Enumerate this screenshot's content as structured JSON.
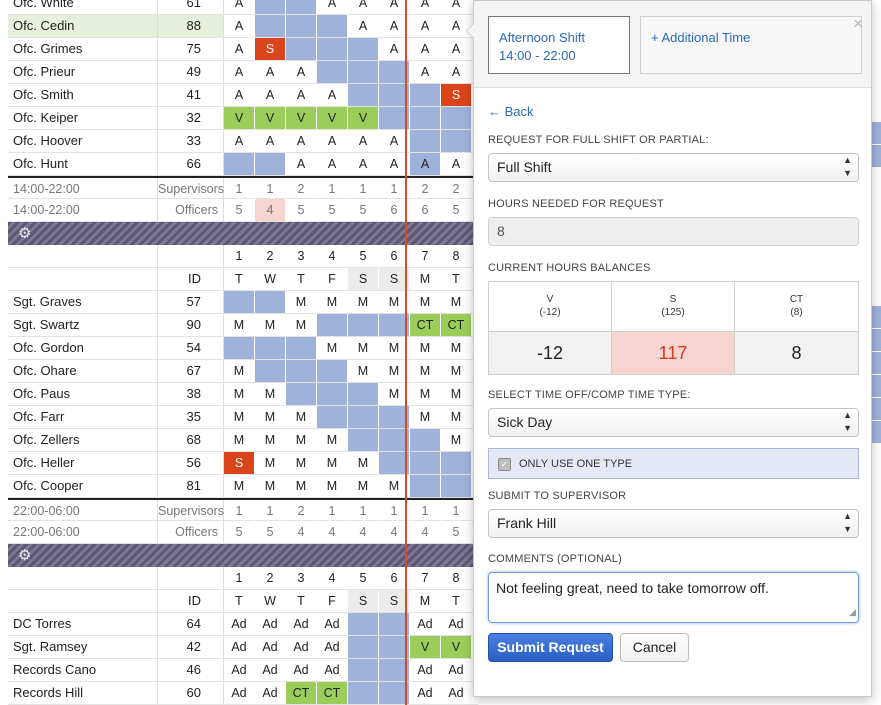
{
  "cols": 8,
  "grid": [
    {
      "kind": "person",
      "name": "Ofc. White",
      "id": "61",
      "cells": [
        [
          "A",
          ""
        ],
        [
          "",
          "blue"
        ],
        [
          "",
          "blue"
        ],
        [
          "A",
          ""
        ],
        [
          "A",
          ""
        ],
        [
          "A",
          ""
        ],
        [
          "A",
          ""
        ],
        [
          "A",
          ""
        ]
      ]
    },
    {
      "kind": "person",
      "name": "Ofc. Cedin",
      "id": "88",
      "hl": true,
      "cells": [
        [
          "A",
          ""
        ],
        [
          "",
          "blue"
        ],
        [
          "",
          "blue"
        ],
        [
          "",
          "blue"
        ],
        [
          "A",
          ""
        ],
        [
          "A",
          ""
        ],
        [
          "A",
          ""
        ],
        [
          "A",
          ""
        ]
      ]
    },
    {
      "kind": "person",
      "name": "Ofc. Grimes",
      "id": "75",
      "cells": [
        [
          "A",
          ""
        ],
        [
          "S",
          "red"
        ],
        [
          "",
          "blue"
        ],
        [
          "",
          "blue"
        ],
        [
          "",
          "blue"
        ],
        [
          "A",
          ""
        ],
        [
          "A",
          ""
        ],
        [
          "A",
          ""
        ]
      ]
    },
    {
      "kind": "person",
      "name": "Ofc. Prieur",
      "id": "49",
      "cells": [
        [
          "A",
          ""
        ],
        [
          "A",
          ""
        ],
        [
          "A",
          ""
        ],
        [
          "",
          "blue"
        ],
        [
          "",
          "blue"
        ],
        [
          "",
          "blue"
        ],
        [
          "A",
          ""
        ],
        [
          "A",
          ""
        ]
      ]
    },
    {
      "kind": "person",
      "name": "Ofc. Smith",
      "id": "41",
      "cells": [
        [
          "A",
          ""
        ],
        [
          "A",
          ""
        ],
        [
          "A",
          ""
        ],
        [
          "A",
          ""
        ],
        [
          "",
          "blue"
        ],
        [
          "",
          "blue"
        ],
        [
          "",
          "blue"
        ],
        [
          "S",
          "red"
        ]
      ]
    },
    {
      "kind": "person",
      "name": "Ofc. Keiper",
      "id": "32",
      "cells": [
        [
          "V",
          "green"
        ],
        [
          "V",
          "green"
        ],
        [
          "V",
          "green"
        ],
        [
          "V",
          "green"
        ],
        [
          "V",
          "green"
        ],
        [
          "",
          "blue"
        ],
        [
          "",
          "blue"
        ],
        [
          "",
          "blue"
        ]
      ]
    },
    {
      "kind": "person",
      "name": "Ofc. Hoover",
      "id": "33",
      "cells": [
        [
          "A",
          ""
        ],
        [
          "A",
          ""
        ],
        [
          "A",
          ""
        ],
        [
          "A",
          ""
        ],
        [
          "A",
          ""
        ],
        [
          "A",
          ""
        ],
        [
          "",
          "blue"
        ],
        [
          "",
          "blue"
        ]
      ]
    },
    {
      "kind": "person",
      "name": "Ofc. Hunt",
      "id": "66",
      "cells": [
        [
          "",
          "blue"
        ],
        [
          "",
          "blue"
        ],
        [
          "A",
          ""
        ],
        [
          "A",
          ""
        ],
        [
          "A",
          ""
        ],
        [
          "A",
          ""
        ],
        [
          "A",
          "blue"
        ],
        [
          "A",
          ""
        ]
      ]
    },
    {
      "kind": "sum",
      "first": true,
      "name": "14:00-22:00",
      "id": "Supervisors",
      "cells": [
        [
          "1",
          ""
        ],
        [
          "1",
          ""
        ],
        [
          "2",
          ""
        ],
        [
          "1",
          ""
        ],
        [
          "1",
          ""
        ],
        [
          "1",
          ""
        ],
        [
          "2",
          ""
        ],
        [
          "2",
          ""
        ]
      ]
    },
    {
      "kind": "sum",
      "name": "14:00-22:00",
      "id": "Officers",
      "cells": [
        [
          "5",
          ""
        ],
        [
          "4",
          "pink"
        ],
        [
          "5",
          ""
        ],
        [
          "5",
          ""
        ],
        [
          "5",
          ""
        ],
        [
          "6",
          ""
        ],
        [
          "6",
          ""
        ],
        [
          "5",
          ""
        ]
      ]
    },
    {
      "kind": "band",
      "gear": "⚙"
    },
    {
      "kind": "hdr",
      "name": "",
      "id": "",
      "cells": [
        [
          "1",
          ""
        ],
        [
          "2",
          ""
        ],
        [
          "3",
          ""
        ],
        [
          "4",
          ""
        ],
        [
          "5",
          ""
        ],
        [
          "6",
          ""
        ],
        [
          "7",
          ""
        ],
        [
          "8",
          ""
        ]
      ]
    },
    {
      "kind": "hdr",
      "name": "",
      "id": "ID",
      "cells": [
        [
          "T",
          ""
        ],
        [
          "W",
          ""
        ],
        [
          "T",
          ""
        ],
        [
          "F",
          ""
        ],
        [
          "S",
          "gray"
        ],
        [
          "S",
          "gray"
        ],
        [
          "M",
          ""
        ],
        [
          "T",
          ""
        ]
      ]
    },
    {
      "kind": "person",
      "name": "Sgt. Graves",
      "id": "57",
      "cells": [
        [
          "",
          "blue"
        ],
        [
          "",
          "blue"
        ],
        [
          "M",
          ""
        ],
        [
          "M",
          ""
        ],
        [
          "M",
          ""
        ],
        [
          "M",
          ""
        ],
        [
          "M",
          ""
        ],
        [
          "M",
          ""
        ]
      ]
    },
    {
      "kind": "person",
      "name": "Sgt. Swartz",
      "id": "90",
      "cells": [
        [
          "M",
          ""
        ],
        [
          "M",
          ""
        ],
        [
          "M",
          ""
        ],
        [
          "",
          "blue"
        ],
        [
          "",
          "blue"
        ],
        [
          "",
          "blue"
        ],
        [
          "CT",
          "green"
        ],
        [
          "CT",
          "green"
        ]
      ]
    },
    {
      "kind": "person",
      "name": "Ofc. Gordon",
      "id": "54",
      "cells": [
        [
          "",
          "blue"
        ],
        [
          "",
          "blue"
        ],
        [
          "",
          "blue"
        ],
        [
          "M",
          ""
        ],
        [
          "M",
          ""
        ],
        [
          "M",
          ""
        ],
        [
          "M",
          ""
        ],
        [
          "M",
          ""
        ]
      ]
    },
    {
      "kind": "person",
      "name": "Ofc. Ohare",
      "id": "67",
      "cells": [
        [
          "M",
          ""
        ],
        [
          "",
          "blue"
        ],
        [
          "",
          "blue"
        ],
        [
          "",
          "blue"
        ],
        [
          "M",
          ""
        ],
        [
          "M",
          ""
        ],
        [
          "M",
          ""
        ],
        [
          "M",
          ""
        ]
      ]
    },
    {
      "kind": "person",
      "name": "Ofc. Paus",
      "id": "38",
      "cells": [
        [
          "M",
          ""
        ],
        [
          "M",
          ""
        ],
        [
          "",
          "blue"
        ],
        [
          "",
          "blue"
        ],
        [
          "",
          "blue"
        ],
        [
          "M",
          ""
        ],
        [
          "M",
          ""
        ],
        [
          "M",
          ""
        ]
      ]
    },
    {
      "kind": "person",
      "name": "Ofc. Farr",
      "id": "35",
      "cells": [
        [
          "M",
          ""
        ],
        [
          "M",
          ""
        ],
        [
          "M",
          ""
        ],
        [
          "",
          "blue"
        ],
        [
          "",
          "blue"
        ],
        [
          "",
          "blue"
        ],
        [
          "M",
          ""
        ],
        [
          "M",
          ""
        ]
      ]
    },
    {
      "kind": "person",
      "name": "Ofc. Zellers",
      "id": "68",
      "cells": [
        [
          "M",
          ""
        ],
        [
          "M",
          ""
        ],
        [
          "M",
          ""
        ],
        [
          "M",
          ""
        ],
        [
          "",
          "blue"
        ],
        [
          "",
          "blue"
        ],
        [
          "",
          "blue"
        ],
        [
          "M",
          ""
        ]
      ]
    },
    {
      "kind": "person",
      "name": "Ofc. Heller",
      "id": "56",
      "cells": [
        [
          "S",
          "red"
        ],
        [
          "M",
          ""
        ],
        [
          "M",
          ""
        ],
        [
          "M",
          ""
        ],
        [
          "M",
          ""
        ],
        [
          "",
          "blue"
        ],
        [
          "",
          "blue"
        ],
        [
          "",
          "blue"
        ]
      ]
    },
    {
      "kind": "person",
      "name": "Ofc. Cooper",
      "id": "81",
      "cells": [
        [
          "M",
          ""
        ],
        [
          "M",
          ""
        ],
        [
          "M",
          ""
        ],
        [
          "M",
          ""
        ],
        [
          "M",
          ""
        ],
        [
          "M",
          ""
        ],
        [
          "",
          "blue"
        ],
        [
          "",
          "blue"
        ]
      ]
    },
    {
      "kind": "sum",
      "first": true,
      "name": "22:00-06:00",
      "id": "Supervisors",
      "cells": [
        [
          "1",
          ""
        ],
        [
          "1",
          ""
        ],
        [
          "2",
          ""
        ],
        [
          "1",
          ""
        ],
        [
          "1",
          ""
        ],
        [
          "1",
          ""
        ],
        [
          "1",
          ""
        ],
        [
          "1",
          ""
        ]
      ]
    },
    {
      "kind": "sum",
      "name": "22:00-06:00",
      "id": "Officers",
      "cells": [
        [
          "5",
          ""
        ],
        [
          "5",
          ""
        ],
        [
          "4",
          ""
        ],
        [
          "4",
          ""
        ],
        [
          "4",
          ""
        ],
        [
          "4",
          ""
        ],
        [
          "4",
          ""
        ],
        [
          "5",
          ""
        ]
      ]
    },
    {
      "kind": "band",
      "gear": "⚙"
    },
    {
      "kind": "hdr",
      "name": "",
      "id": "",
      "cells": [
        [
          "1",
          ""
        ],
        [
          "2",
          ""
        ],
        [
          "3",
          ""
        ],
        [
          "4",
          ""
        ],
        [
          "5",
          ""
        ],
        [
          "6",
          ""
        ],
        [
          "7",
          ""
        ],
        [
          "8",
          ""
        ]
      ]
    },
    {
      "kind": "hdr",
      "name": "",
      "id": "ID",
      "cells": [
        [
          "T",
          ""
        ],
        [
          "W",
          ""
        ],
        [
          "T",
          ""
        ],
        [
          "F",
          ""
        ],
        [
          "S",
          "gray"
        ],
        [
          "S",
          "gray"
        ],
        [
          "M",
          ""
        ],
        [
          "T",
          ""
        ]
      ]
    },
    {
      "kind": "person",
      "name": "DC Torres",
      "id": "64",
      "cells": [
        [
          "Ad",
          ""
        ],
        [
          "Ad",
          ""
        ],
        [
          "Ad",
          ""
        ],
        [
          "Ad",
          ""
        ],
        [
          "",
          "blue"
        ],
        [
          "",
          "blue"
        ],
        [
          "Ad",
          ""
        ],
        [
          "Ad",
          ""
        ]
      ]
    },
    {
      "kind": "person",
      "name": "Sgt. Ramsey",
      "id": "42",
      "cells": [
        [
          "Ad",
          ""
        ],
        [
          "Ad",
          ""
        ],
        [
          "Ad",
          ""
        ],
        [
          "Ad",
          ""
        ],
        [
          "",
          "blue"
        ],
        [
          "",
          "blue"
        ],
        [
          "V",
          "green"
        ],
        [
          "V",
          "green"
        ]
      ]
    },
    {
      "kind": "person",
      "name": "Records Cano",
      "id": "46",
      "cells": [
        [
          "Ad",
          ""
        ],
        [
          "Ad",
          ""
        ],
        [
          "Ad",
          ""
        ],
        [
          "Ad",
          ""
        ],
        [
          "",
          "blue"
        ],
        [
          "",
          "blue"
        ],
        [
          "Ad",
          ""
        ],
        [
          "Ad",
          ""
        ]
      ]
    },
    {
      "kind": "person",
      "name": "Records Hill",
      "id": "60",
      "cells": [
        [
          "Ad",
          ""
        ],
        [
          "Ad",
          ""
        ],
        [
          "CT",
          "green"
        ],
        [
          "CT",
          "green"
        ],
        [
          "",
          "blue"
        ],
        [
          "",
          "blue"
        ],
        [
          "Ad",
          ""
        ],
        [
          "Ad",
          ""
        ]
      ]
    }
  ],
  "popover": {
    "tab_active_line1": "Afternoon Shift",
    "tab_active_line2": "14:00 - 22:00",
    "tab_other": "+ Additional Time",
    "close": "×",
    "back": "← Back",
    "label_full_partial": "REQUEST FOR FULL SHIFT OR PARTIAL:",
    "full_partial_value": "Full Shift",
    "label_hours": "HOURS NEEDED FOR REQUEST",
    "hours_value": "8",
    "label_balances": "CURRENT HOURS BALANCES",
    "balances": [
      {
        "code": "V",
        "sub": "(-12)",
        "value": "-12",
        "negative": false
      },
      {
        "code": "S",
        "sub": "(125)",
        "value": "117",
        "negative": true
      },
      {
        "code": "CT",
        "sub": "(8)",
        "value": "8",
        "negative": false
      }
    ],
    "label_type": "SELECT TIME OFF/COMP TIME TYPE:",
    "type_value": "Sick Day",
    "only_one_type": "ONLY USE ONE TYPE",
    "label_supervisor": "SUBMIT TO SUPERVISOR",
    "supervisor_value": "Frank Hill",
    "label_comments": "COMMENTS (OPTIONAL)",
    "comments_value": "Not feeling great, need to take tomorrow off.",
    "submit": "Submit Request",
    "cancel": "Cancel"
  },
  "colors": {
    "accent": "#2c6ab4",
    "scheduled": "#9fb2d9",
    "leave": "#9ccd5a",
    "sick": "#d9441a",
    "today_line": "#d44a2a"
  }
}
